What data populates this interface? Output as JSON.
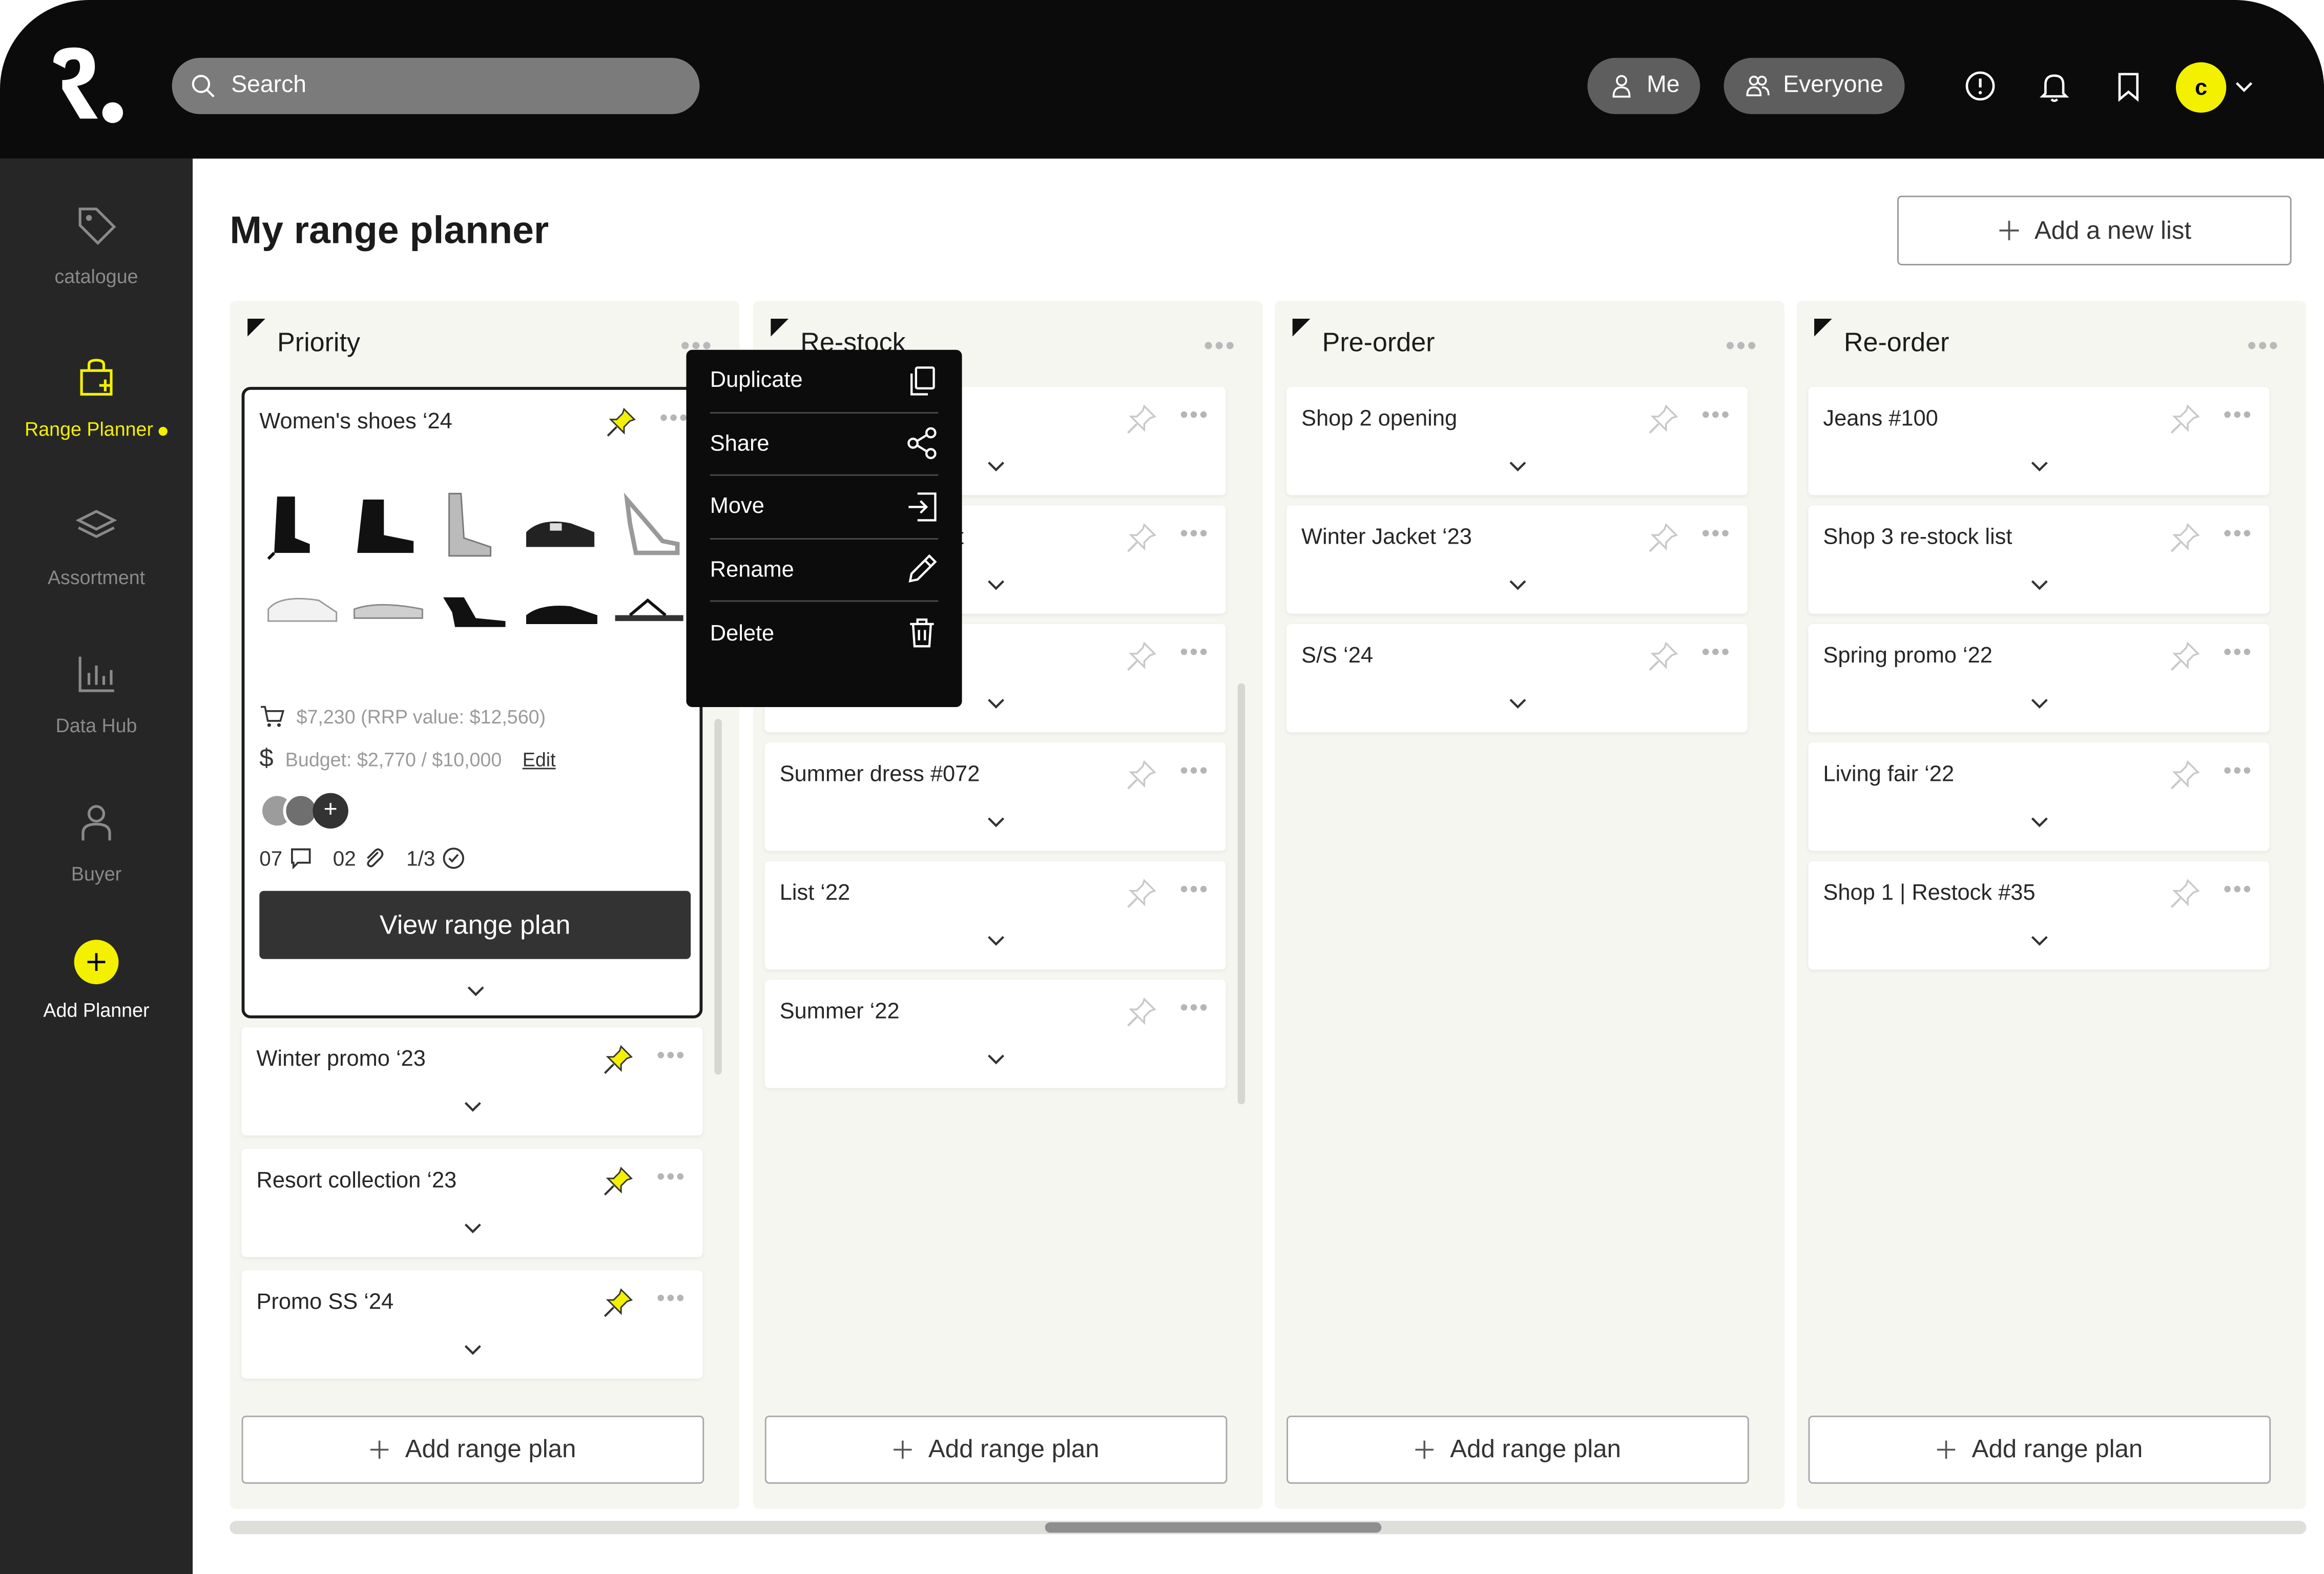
{
  "app": {
    "title": "My range planner",
    "accent": "#f3f000"
  },
  "topbar": {
    "search_placeholder": "Search",
    "me_label": "Me",
    "everyone_label": "Everyone",
    "avatar_initial": "c"
  },
  "sidebar": {
    "items": [
      {
        "label": "catalogue",
        "icon": "tag-icon"
      },
      {
        "label": "Range Planner",
        "icon": "bag-plus-icon"
      },
      {
        "label": "Assortment",
        "icon": "layers-icon"
      },
      {
        "label": "Data Hub",
        "icon": "bar-chart-icon"
      },
      {
        "label": "Buyer",
        "icon": "user-icon"
      },
      {
        "label": "Add Planner",
        "icon": "plus-icon"
      }
    ]
  },
  "main": {
    "add_list_label": "Add a new list",
    "add_range_plan_label": "Add range plan",
    "columns": [
      {
        "title": "Priority",
        "expanded": {
          "title": "Women's shoes ‘24",
          "price": "$7,230 (RRP value: $12,560)",
          "budget": "Budget: $2,770 / $10,000",
          "edit_label": "Edit",
          "comments": "07",
          "attachments": "02",
          "tasks": "1/3",
          "view_label": "View range plan"
        },
        "cards": [
          "Winter promo ‘23",
          "Resort collection ‘23",
          "Promo SS ‘24"
        ]
      },
      {
        "title": "Re-stock",
        "cards": [
          "",
          "",
          "",
          "Summer dress #072",
          "List ‘22",
          "Summer ‘22"
        ],
        "partial_text": "t"
      },
      {
        "title": "Pre-order",
        "cards": [
          "Shop 2 opening",
          "Winter Jacket ‘23",
          "S/S ‘24"
        ]
      },
      {
        "title": "Re-order",
        "cards": [
          "Jeans #100",
          "Shop 3 re-stock list",
          "Spring promo ‘22",
          "Living fair ‘22",
          "Shop 1 | Restock #35"
        ]
      }
    ]
  },
  "context_menu": {
    "items": [
      {
        "label": "Duplicate",
        "icon": "copy-icon"
      },
      {
        "label": "Share",
        "icon": "share-icon"
      },
      {
        "label": "Move",
        "icon": "move-icon"
      },
      {
        "label": "Rename",
        "icon": "pencil-icon"
      },
      {
        "label": "Delete",
        "icon": "trash-icon"
      }
    ]
  }
}
